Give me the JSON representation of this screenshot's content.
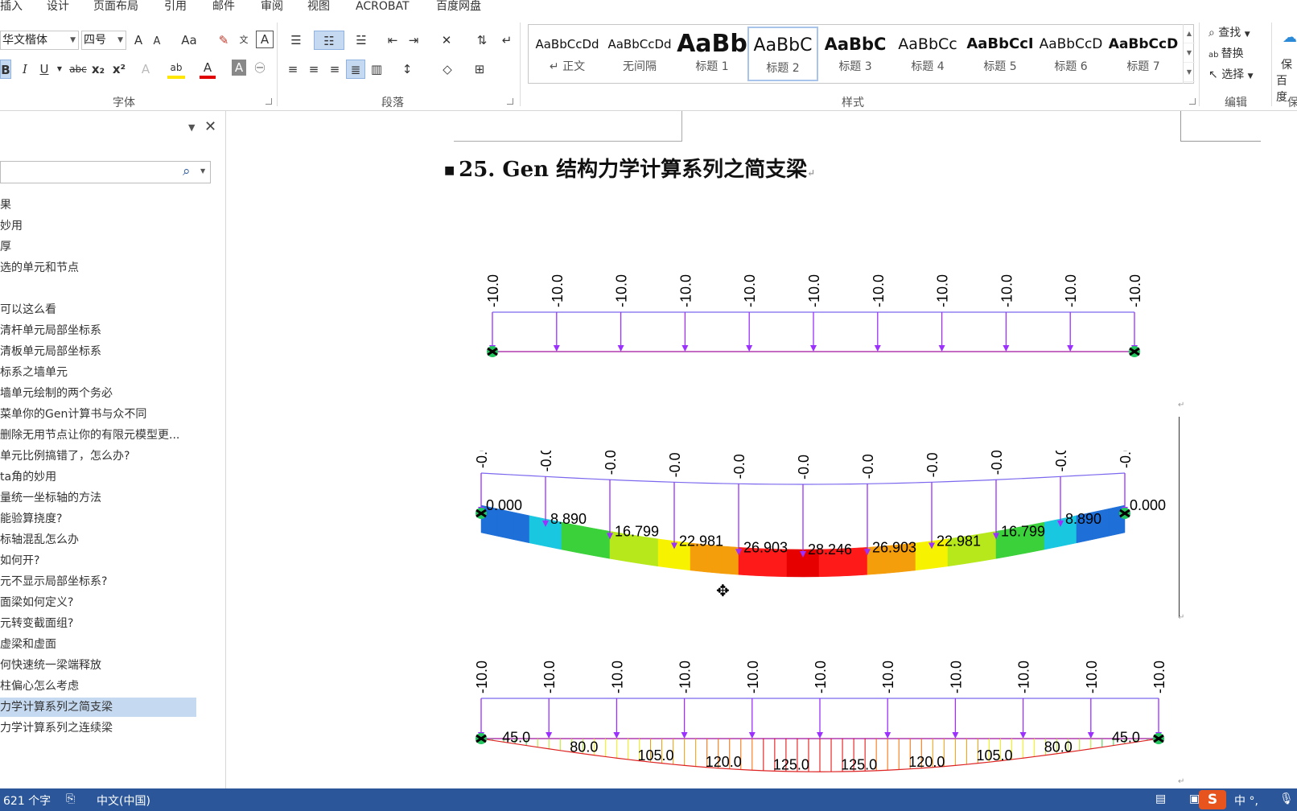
{
  "menu": [
    "插入",
    "设计",
    "页面布局",
    "引用",
    "邮件",
    "审阅",
    "视图",
    "ACROBAT",
    "百度网盘"
  ],
  "font": {
    "name": "华文楷体",
    "size": "四号",
    "group_label": "字体",
    "grow": "A",
    "shrink": "A",
    "case": "Aa",
    "bold": "B",
    "italic": "I",
    "underline": "U",
    "strike": "abc",
    "sub": "x₂",
    "sup": "x²",
    "highlight_label": "ab",
    "color_label": "A"
  },
  "paragraph": {
    "group_label": "段落"
  },
  "styles": {
    "group_label": "样式",
    "items": [
      {
        "sample": "AaBbCcDd",
        "name": "↵ 正文"
      },
      {
        "sample": "AaBbCcDd",
        "name": "无间隔"
      },
      {
        "sample": "AaBb",
        "name": "标题 1"
      },
      {
        "sample": "AaBbC",
        "name": "标题 2"
      },
      {
        "sample": "AaBbC",
        "name": "标题 3"
      },
      {
        "sample": "AaBbCc",
        "name": "标题 4"
      },
      {
        "sample": "AaBbCcI",
        "name": "标题 5"
      },
      {
        "sample": "AaBbCcD",
        "name": "标题 6"
      },
      {
        "sample": "AaBbCcD",
        "name": "标题 7"
      }
    ]
  },
  "editing": {
    "group_label": "编辑",
    "find": "查找",
    "replace": "替换",
    "select": "选择",
    "save_label_1": "保",
    "save_label_2": "百度",
    "save_group": "保"
  },
  "nav": {
    "items": [
      "果",
      "妙用",
      "厚",
      "选的单元和节点",
      "",
      "可以这么看",
      "清杆单元局部坐标系",
      "清板单元局部坐标系",
      "标系之墙单元",
      "墙单元绘制的两个务必",
      "菜单你的Gen计算书与众不同",
      "删除无用节点让你的有限元模型更...",
      "单元比例搞错了，怎么办?",
      "ta角的妙用",
      "量统一坐标轴的方法",
      "能验算挠度?",
      "标轴混乱怎么办",
      "如何开?",
      "元不显示局部坐标系?",
      "面梁如何定义?",
      "元转变截面组?",
      "虚梁和虚面",
      "何快速统一梁端释放",
      "柱偏心怎么考虑",
      "力学计算系列之简支梁",
      "力学计算系列之连续梁"
    ],
    "selected_index": 24
  },
  "doc": {
    "heading": "25. Gen 结构力学计算系列之简支梁"
  },
  "diagrams": {
    "load_top": "-10.0",
    "load_mid": "-0.0",
    "deflection_values": [
      "0.000",
      "8.890",
      "16.799",
      "22.981",
      "26.903",
      "28.246",
      "26.903",
      "22.981",
      "16.799",
      "8.890",
      "0.000"
    ],
    "moment_values": [
      "45.0",
      "80.0",
      "105.0",
      "120.0",
      "125.0",
      "125.0",
      "120.0",
      "105.0",
      "80.0",
      "45.0"
    ],
    "accent_load": "#9b30ff",
    "beam_line": "#7b68ee"
  },
  "status": {
    "words": "621 个字",
    "language": "中文(中国)",
    "ime": "中 °,"
  },
  "colors": {
    "status_bar": "#2b579a",
    "selected": "#c5d9f1"
  }
}
